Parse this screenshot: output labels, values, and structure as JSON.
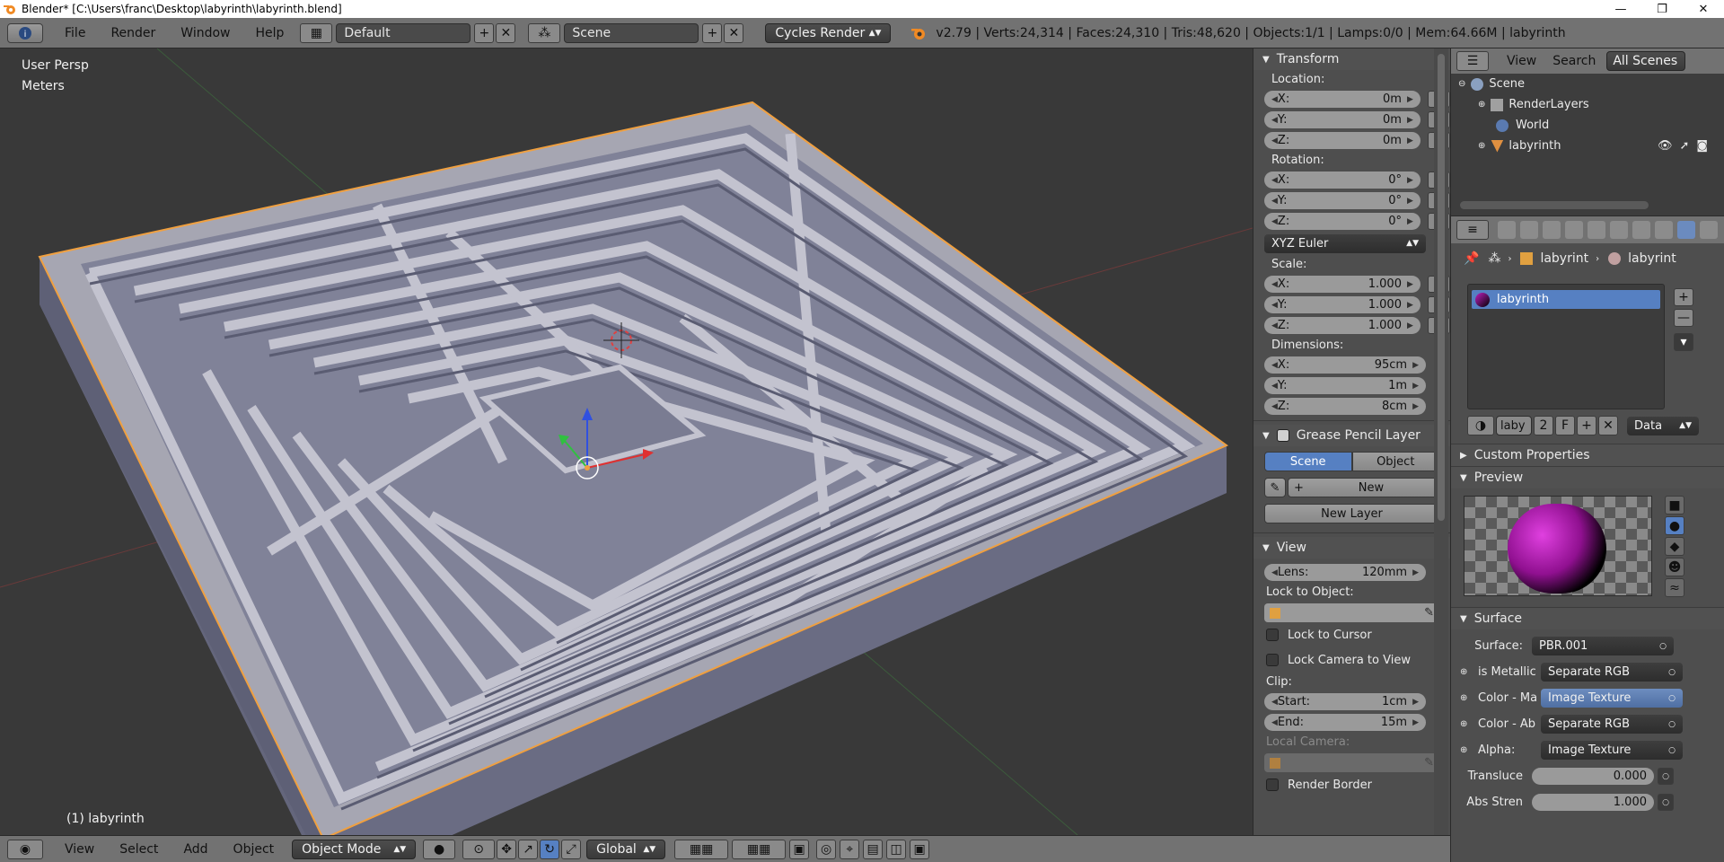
{
  "window": {
    "title": "Blender* [C:\\Users\\franc\\Desktop\\labyrinth\\labyrinth.blend]",
    "controls": [
      "—",
      "❐",
      "✕"
    ]
  },
  "info_header": {
    "menus": [
      "File",
      "Render",
      "Window",
      "Help"
    ],
    "screen_layout": "Default",
    "scene": "Scene",
    "render_engine": "Cycles Render",
    "stats": "v2.79 | Verts:24,314 | Faces:24,310 | Tris:48,620 | Objects:1/1 | Lamps:0/0 | Mem:64.66M | labyrinth"
  },
  "viewport": {
    "view_name": "User Persp",
    "units": "Meters",
    "object_label": "(1) labyrinth"
  },
  "bottom_bar": {
    "menus": [
      "View",
      "Select",
      "Add",
      "Object"
    ],
    "mode": "Object Mode",
    "orientation": "Global"
  },
  "npanel": {
    "transform_title": "Transform",
    "location_label": "Location:",
    "location": [
      {
        "axis": "X:",
        "value": "0m"
      },
      {
        "axis": "Y:",
        "value": "0m"
      },
      {
        "axis": "Z:",
        "value": "0m"
      }
    ],
    "rotation_label": "Rotation:",
    "rotation": [
      {
        "axis": "X:",
        "value": "0°"
      },
      {
        "axis": "Y:",
        "value": "0°"
      },
      {
        "axis": "Z:",
        "value": "0°"
      }
    ],
    "rotation_mode": "XYZ Euler",
    "scale_label": "Scale:",
    "scale": [
      {
        "axis": "X:",
        "value": "1.000"
      },
      {
        "axis": "Y:",
        "value": "1.000"
      },
      {
        "axis": "Z:",
        "value": "1.000"
      }
    ],
    "dimensions_label": "Dimensions:",
    "dimensions": [
      {
        "axis": "X:",
        "value": "95cm"
      },
      {
        "axis": "Y:",
        "value": "1m"
      },
      {
        "axis": "Z:",
        "value": "8cm"
      }
    ],
    "grease_title": "Grease Pencil Layer",
    "grease_scene": "Scene",
    "grease_object": "Object",
    "grease_new": "New",
    "grease_new_layer": "New Layer",
    "view_title": "View",
    "lens_label": "Lens:",
    "lens_value": "120mm",
    "lock_to_object": "Lock to Object:",
    "lock_to_cursor": "Lock to Cursor",
    "lock_camera": "Lock Camera to View",
    "clip_label": "Clip:",
    "clip_start_label": "Start:",
    "clip_start": "1cm",
    "clip_end_label": "End:",
    "clip_end": "15m",
    "local_camera": "Local Camera:",
    "render_border": "Render Border"
  },
  "outliner": {
    "menus": [
      "View",
      "Search"
    ],
    "filter": "All Scenes",
    "items": [
      {
        "label": "Scene",
        "indent": 0
      },
      {
        "label": "RenderLayers",
        "indent": 1
      },
      {
        "label": "World",
        "indent": 1
      },
      {
        "label": "labyrinth",
        "indent": 1
      }
    ]
  },
  "properties": {
    "breadcrumb": [
      "labyrint",
      "labyrint"
    ],
    "slot_name": "labyrinth",
    "datablock": {
      "name": "laby",
      "users": "2",
      "fake": "F",
      "link": "Data"
    },
    "custom_props": "Custom Properties",
    "preview": "Preview",
    "surface_title": "Surface",
    "surface_rows": [
      {
        "label": "Surface:",
        "value": "PBR.001",
        "selected": false
      },
      {
        "label": "is Metallic",
        "value": "Separate RGB",
        "selected": false
      },
      {
        "label": "Color - Ma",
        "value": "Image Texture",
        "selected": true
      },
      {
        "label": "Color - Ab",
        "value": "Separate RGB",
        "selected": false
      },
      {
        "label": "Alpha:",
        "value": "Image Texture",
        "selected": false
      }
    ],
    "translucency_label": "Transluce",
    "translucency": "0.000",
    "abs_strength_label": "Abs Stren",
    "abs_strength": "1.000"
  },
  "colors": {
    "header": "#727272",
    "viewport_bg": "#393939",
    "panel": "#4e4e4e",
    "selection_outline": "#f0a040",
    "active_blue": "#5680c2"
  }
}
